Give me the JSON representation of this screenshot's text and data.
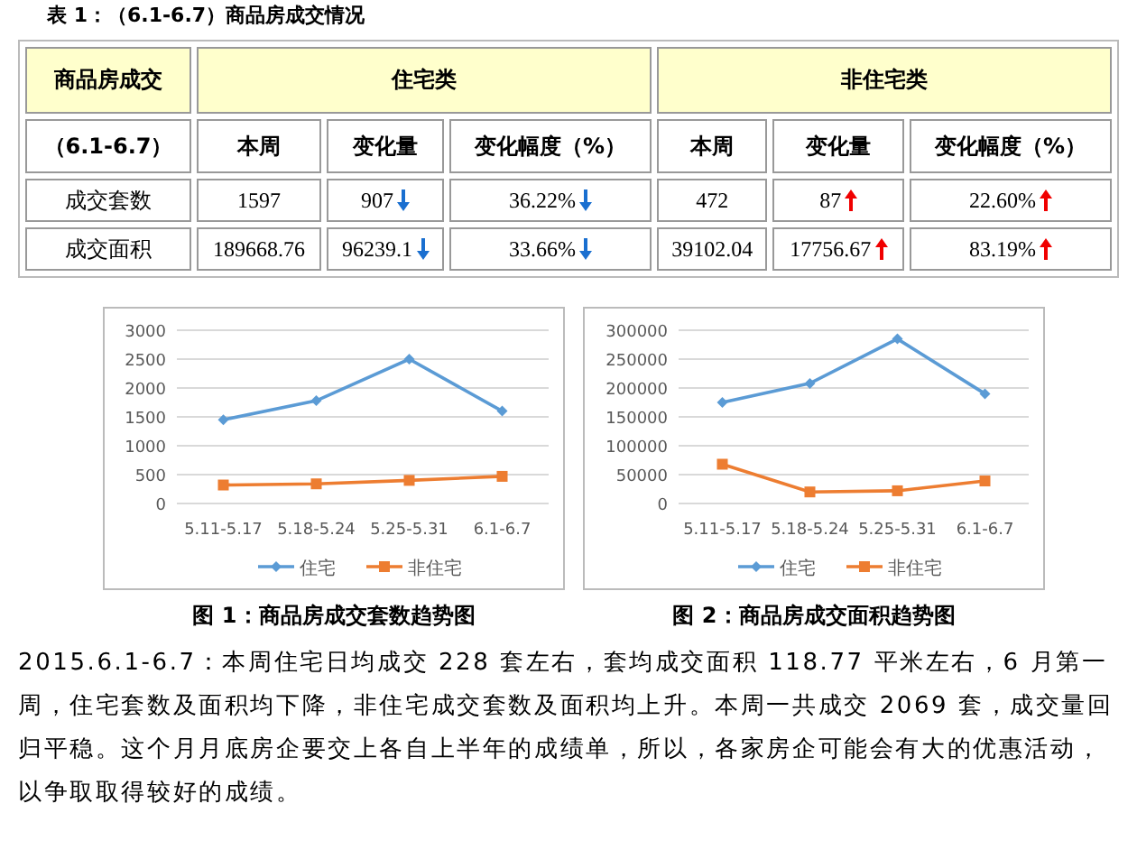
{
  "table_title": "表 1：（6.1-6.7）商品房成交情况",
  "table": {
    "corner": "商品房成交",
    "groups": [
      "住宅类",
      "非住宅类"
    ],
    "period": "（6.1-6.7）",
    "columns": [
      "本周",
      "变化量",
      "变化幅度（%）",
      "本周",
      "变化量",
      "变化幅度（%）"
    ],
    "rows": [
      {
        "label": "成交套数",
        "cells": [
          {
            "text": "1597"
          },
          {
            "text": "907",
            "rising": false
          },
          {
            "text": "36.22%",
            "rising": false
          },
          {
            "text": "472"
          },
          {
            "text": "87",
            "rising": true
          },
          {
            "text": "22.60%",
            "rising": true
          }
        ]
      },
      {
        "label": "成交面积",
        "cells": [
          {
            "text": "189668.76"
          },
          {
            "text": "96239.1",
            "rising": false
          },
          {
            "text": "33.66%",
            "rising": false
          },
          {
            "text": "39102.04"
          },
          {
            "text": "17756.67",
            "rising": true
          },
          {
            "text": "83.19%",
            "rising": true
          }
        ]
      }
    ]
  },
  "charts": [
    {
      "caption": "图 1：商品房成交套数趋势图",
      "chart_data": {
        "type": "line",
        "categories": [
          "5.11-5.17",
          "5.18-5.24",
          "5.25-5.31",
          "6.1-6.7"
        ],
        "ylim": [
          0,
          3000
        ],
        "yticks": [
          0,
          500,
          1000,
          1500,
          2000,
          2500,
          3000
        ],
        "grid": "y",
        "legend": "bottom",
        "series": [
          {
            "name": "住宅",
            "color": "#5b9bd5",
            "marker": "diamond",
            "values": [
              1450,
              1780,
              2500,
              1600
            ]
          },
          {
            "name": "非住宅",
            "color": "#ed7d31",
            "marker": "square",
            "values": [
              320,
              340,
              400,
              470
            ]
          }
        ]
      }
    },
    {
      "caption": "图 2：商品房成交面积趋势图",
      "chart_data": {
        "type": "line",
        "categories": [
          "5.11-5.17",
          "5.18-5.24",
          "5.25-5.31",
          "6.1-6.7"
        ],
        "ylim": [
          0,
          300000
        ],
        "yticks": [
          0,
          50000,
          100000,
          150000,
          200000,
          250000,
          300000
        ],
        "grid": "y",
        "legend": "bottom",
        "series": [
          {
            "name": "住宅",
            "color": "#5b9bd5",
            "marker": "diamond",
            "values": [
              175000,
              208000,
              285000,
              190000
            ]
          },
          {
            "name": "非住宅",
            "color": "#ed7d31",
            "marker": "square",
            "values": [
              68000,
              20000,
              22000,
              39000
            ]
          }
        ]
      }
    }
  ],
  "paragraph": "2015.6.1-6.7：本周住宅日均成交 228 套左右，套均成交面积 118.77 平米左右，6 月第一周，住宅套数及面积均下降，非住宅成交套数及面积均上升。本周一共成交 2069 套，成交量回归平稳。这个月月底房企要交上各自上半年的成绩单，所以，各家房企可能会有大的优惠活动，以争取取得较好的成绩。"
}
